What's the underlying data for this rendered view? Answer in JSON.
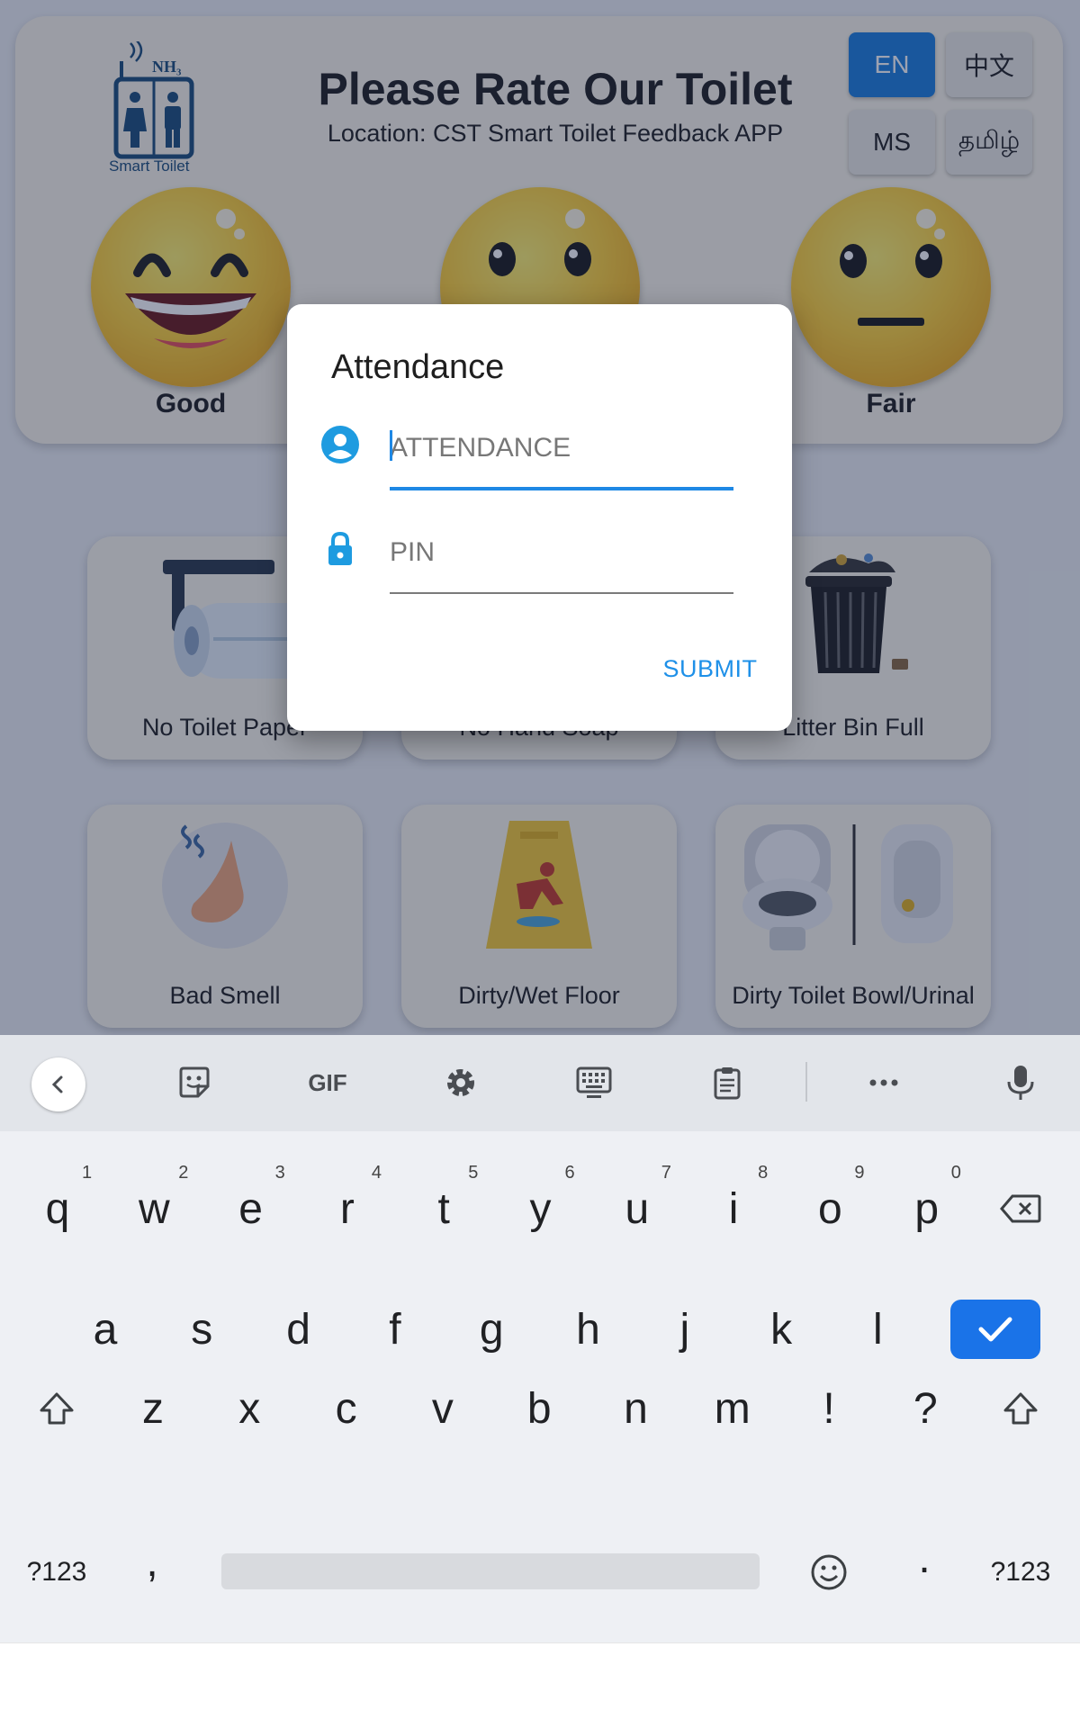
{
  "header": {
    "logo_text": "Smart Toilet",
    "logo_symbol": "NH₃",
    "title": "Please Rate Our Toilet",
    "subtitle": "Location: CST Smart Toilet Feedback APP"
  },
  "languages": [
    {
      "label": "EN",
      "active": true
    },
    {
      "label": "中文",
      "active": false
    },
    {
      "label": "MS",
      "active": false
    },
    {
      "label": "தமிழ்",
      "active": false
    }
  ],
  "ratings": [
    {
      "label": "Good",
      "icon": "laughing-face-icon"
    },
    {
      "label": "",
      "icon": "smiling-face-icon"
    },
    {
      "label": "Fair",
      "icon": "neutral-face-icon"
    }
  ],
  "issues": [
    {
      "label": "No Toilet Paper",
      "icon": "toilet-paper-icon"
    },
    {
      "label": "No Hand Soap",
      "icon": "hand-soap-icon"
    },
    {
      "label": "Litter Bin Full",
      "icon": "trash-bin-icon"
    },
    {
      "label": "Bad Smell",
      "icon": "nose-icon"
    },
    {
      "label": "Dirty/Wet Floor",
      "icon": "wet-floor-sign-icon"
    },
    {
      "label": "Dirty Toilet Bowl/Urinal",
      "icon": "toilet-urinal-icon"
    }
  ],
  "dialog": {
    "title": "Attendance",
    "attendance_placeholder": "ATTENDANCE",
    "attendance_value": "",
    "pin_placeholder": "PIN",
    "pin_value": "",
    "submit_label": "SUBMIT",
    "accent_color": "#1e88e5"
  },
  "keyboard": {
    "toolbar": {
      "gif_label": "GIF"
    },
    "row1": [
      {
        "key": "q",
        "hint": "1"
      },
      {
        "key": "w",
        "hint": "2"
      },
      {
        "key": "e",
        "hint": "3"
      },
      {
        "key": "r",
        "hint": "4"
      },
      {
        "key": "t",
        "hint": "5"
      },
      {
        "key": "y",
        "hint": "6"
      },
      {
        "key": "u",
        "hint": "7"
      },
      {
        "key": "i",
        "hint": "8"
      },
      {
        "key": "o",
        "hint": "9"
      },
      {
        "key": "p",
        "hint": "0"
      }
    ],
    "row2": [
      "a",
      "s",
      "d",
      "f",
      "g",
      "h",
      "j",
      "k",
      "l"
    ],
    "row3": [
      "z",
      "x",
      "c",
      "v",
      "b",
      "n",
      "m",
      "!",
      "?"
    ],
    "row4": {
      "symbols_left": "?123",
      "comma": ",",
      "period": ".",
      "symbols_right": "?123"
    }
  }
}
